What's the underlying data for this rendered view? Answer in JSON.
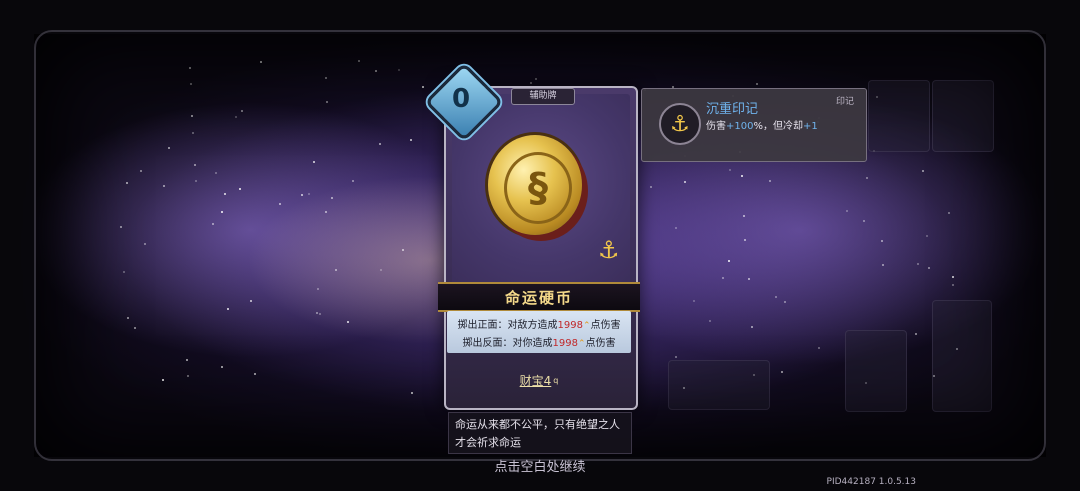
{
  "card": {
    "cost": "0",
    "type_label": "辅助牌",
    "name": "命运硬币",
    "effect_heads_prefix": "掷出正面：对敌方造成",
    "effect_heads_value": "1998",
    "effect_heads_suffix": "点伤害",
    "effect_tails_prefix": "掷出反面：对你造成",
    "effect_tails_value": "1998",
    "effect_tails_suffix": "点伤害",
    "tag": "财宝4",
    "tag_suffix": "q",
    "icon": "anchor-icon"
  },
  "flavor": "命运从来都不公平，只有绝望之人才会祈求命运",
  "continue_hint": "点击空白处继续",
  "version": "PID442187  1.0.5.13",
  "tooltip": {
    "title": "沉重印记",
    "tag": "印记",
    "desc_prefix": "伤害",
    "desc_value1": "+100",
    "desc_mid": "%，但冷却",
    "desc_value2": "+1",
    "icon": "anchor-icon"
  },
  "colors": {
    "accent_blue": "#6fb3ec",
    "damage_red": "#c0282a",
    "gold": "#f4d98a"
  }
}
